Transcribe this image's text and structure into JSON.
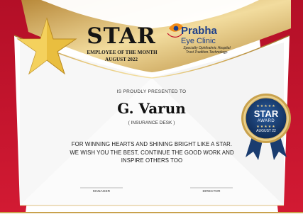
{
  "certificate": {
    "title": "STAR",
    "subtitle": "EMPLOYEE OF THE MONTH",
    "period": "AUGUST 2022",
    "presented_text": "IS PROUDLY PRESENTED TO",
    "recipient": "G. Varun",
    "department": "( INSURANCE DESK )",
    "message": "FOR WINNING HEARTS AND SHINING BRIGHT LIKE A STAR. WE WISH YOU THE BEST, CONTINUE THE GOOD WORK AND INSPIRE OTHERS TOO",
    "signature_left": "MANAGER",
    "signature_right": "DIRECTOR"
  },
  "logo": {
    "name": "Prabha",
    "name_line2": "Eye Clinic",
    "tagline1": "Specialty Ophthalmic Hospital",
    "tagline2": "Trust.Tradition.Technology."
  },
  "badge": {
    "title": "STAR",
    "label": "AWARD",
    "date": "AUGUST 22",
    "stars": "★★★★★"
  },
  "colors": {
    "red": "#c5122b",
    "gold": "#c9a24d",
    "navy": "#163a6e",
    "logo_blue": "#1d3f8a",
    "logo_orange": "#f28c1a"
  },
  "icons": [
    "gold-star-icon",
    "logo-eye-icon",
    "award-rosette-icon"
  ]
}
